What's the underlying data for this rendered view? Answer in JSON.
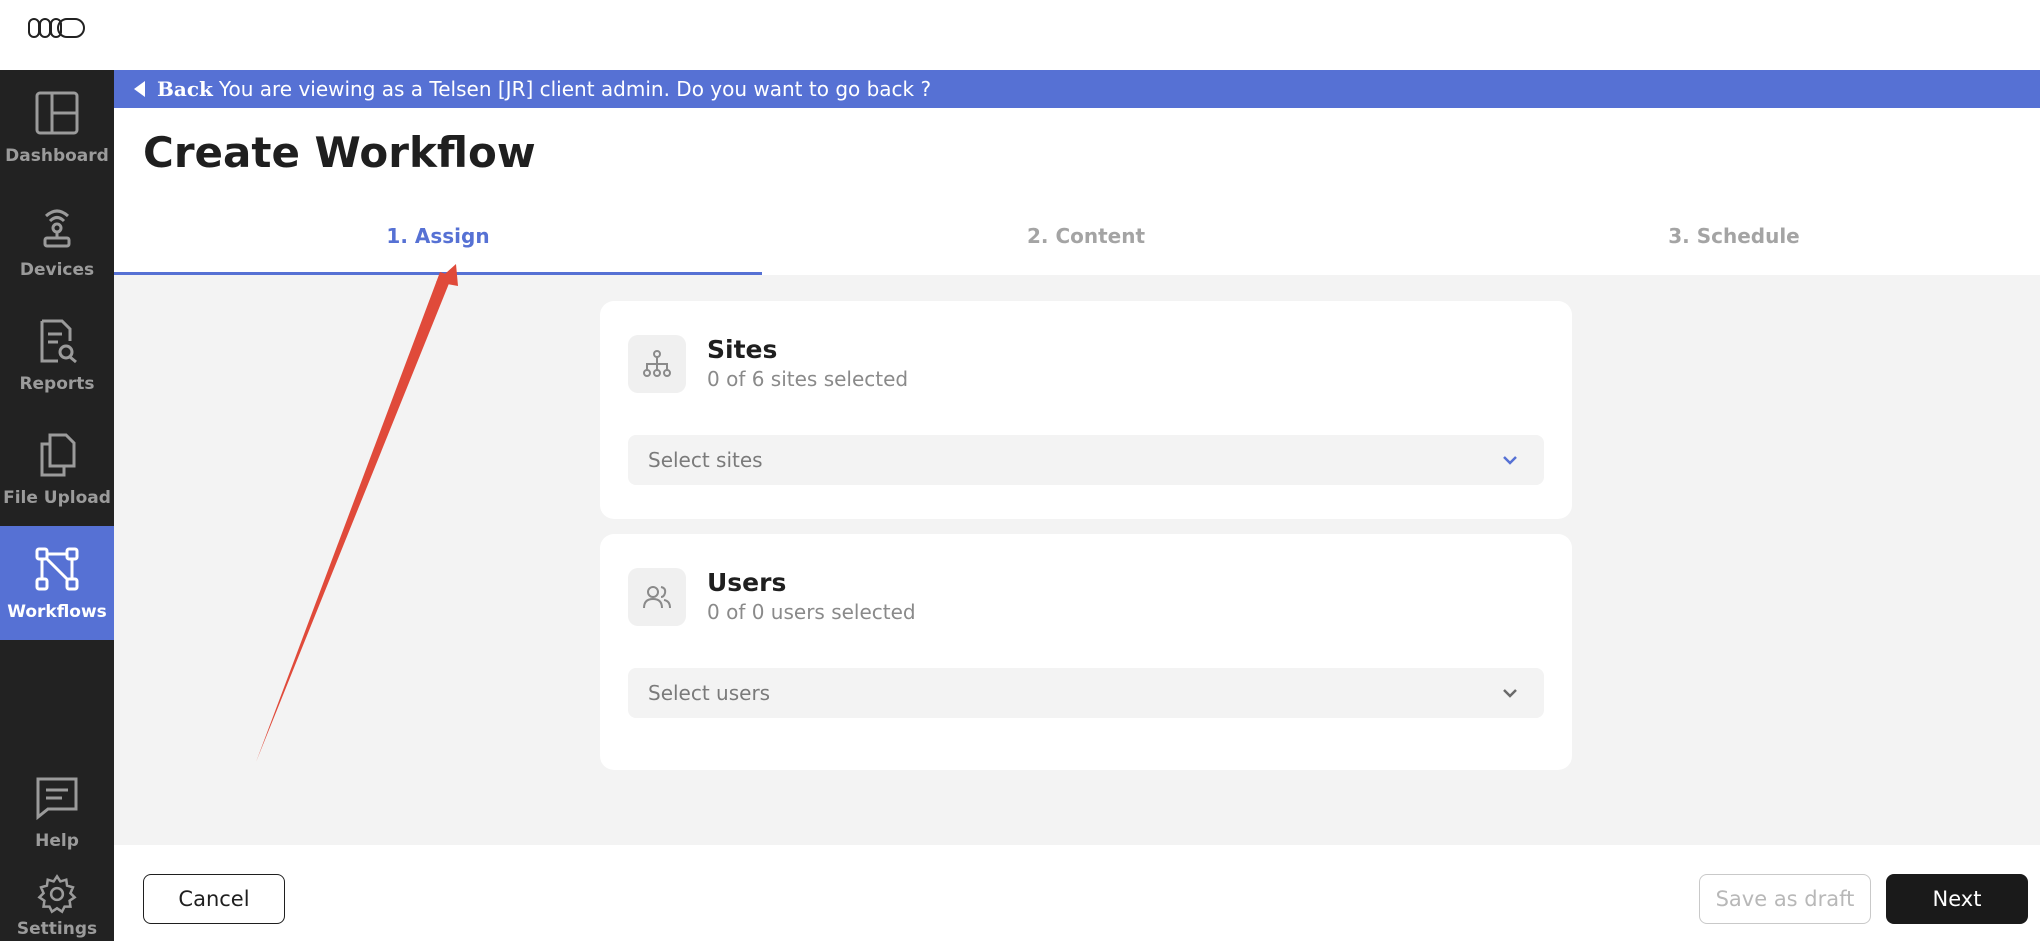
{
  "nav": {
    "items": [
      {
        "label": "Dashboard",
        "icon": "dashboard-icon"
      },
      {
        "label": "Devices",
        "icon": "devices-icon"
      },
      {
        "label": "Reports",
        "icon": "reports-icon"
      },
      {
        "label": "File Upload",
        "icon": "file-upload-icon"
      },
      {
        "label": "Workflows",
        "icon": "workflows-icon",
        "active": true
      },
      {
        "label": "Help",
        "icon": "help-icon"
      },
      {
        "label": "Settings",
        "icon": "settings-icon"
      }
    ]
  },
  "banner": {
    "back_label": "Back",
    "message": "You are viewing as a Telsen [JR] client admin. Do you want to go back ?"
  },
  "page": {
    "title": "Create Workflow"
  },
  "tabs": [
    {
      "label": "1. Assign",
      "active": true
    },
    {
      "label": "2. Content"
    },
    {
      "label": "3. Schedule"
    }
  ],
  "sites": {
    "title": "Sites",
    "subtitle": "0 of 6 sites selected",
    "placeholder": "Select sites"
  },
  "users": {
    "title": "Users",
    "subtitle": "0 of 0 users selected",
    "placeholder": "Select users"
  },
  "footer": {
    "cancel_label": "Cancel",
    "draft_label": "Save as draft",
    "next_label": "Next"
  },
  "colors": {
    "accent": "#5671d4",
    "sidebar": "#222222",
    "annotation_arrow": "#e04a3a"
  }
}
